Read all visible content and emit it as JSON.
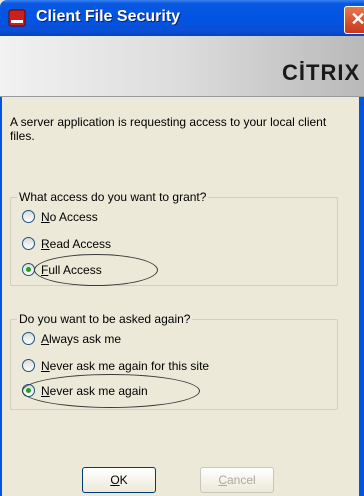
{
  "window": {
    "title": "Client File Security",
    "close_symbol": "✕"
  },
  "banner": {
    "logo_text": "CİTRIX"
  },
  "message": "A server application is requesting access to your local client files.",
  "access_group": {
    "legend": "What access do you want to grant?",
    "options": [
      {
        "label_key": "N",
        "label_rest": "o Access",
        "checked": false
      },
      {
        "label_key": "R",
        "label_rest": "ead Access",
        "checked": false
      },
      {
        "label_key": "F",
        "label_rest": "ull Access",
        "checked": true
      }
    ]
  },
  "ask_group": {
    "legend": "Do you want to be asked again?",
    "options": [
      {
        "label_key": "A",
        "label_rest": "lways ask me",
        "checked": false
      },
      {
        "label_key": "N",
        "label_rest": "ever ask me again for this site",
        "checked": false
      },
      {
        "label_key": "N",
        "label_rest": "ever ask me again",
        "checked": true
      }
    ]
  },
  "buttons": {
    "ok_key": "O",
    "ok_rest": "K",
    "cancel_key": "C",
    "cancel_rest": "ancel"
  },
  "colors": {
    "titlebar": "#0054e3",
    "dialog_bg": "#ece9d8",
    "radio_dot": "#21a121"
  },
  "icons": {
    "title": "citrix-shield-icon",
    "close": "close-icon"
  }
}
